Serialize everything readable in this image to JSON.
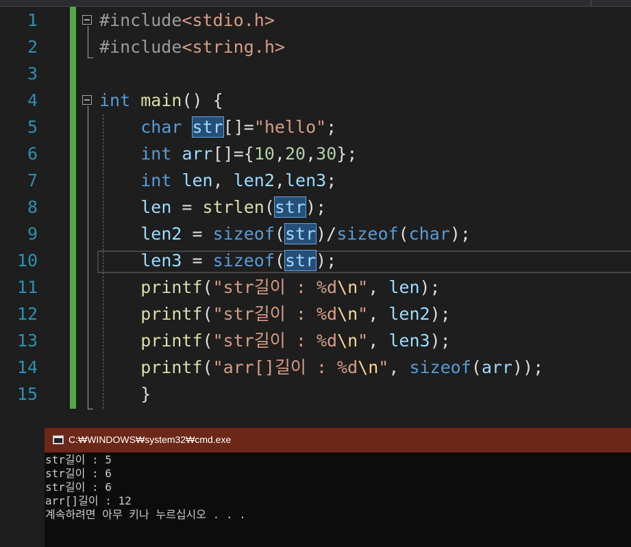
{
  "editor": {
    "lines": [
      {
        "num": "1",
        "segs": [
          [
            "#include",
            "inc"
          ],
          [
            "<stdio.h>",
            "str"
          ]
        ]
      },
      {
        "num": "2",
        "segs": [
          [
            "#include",
            "inc"
          ],
          [
            "<string.h>",
            "str"
          ]
        ]
      },
      {
        "num": "3",
        "segs": []
      },
      {
        "num": "4",
        "segs": [
          [
            "int",
            "kw"
          ],
          [
            " ",
            ""
          ],
          [
            "main",
            "fn"
          ],
          [
            "() {",
            ""
          ]
        ]
      },
      {
        "num": "5",
        "segs": [
          [
            "    ",
            ""
          ],
          [
            "char",
            "kw"
          ],
          [
            " ",
            ""
          ],
          [
            "str",
            "var hl"
          ],
          [
            "[]=",
            ""
          ],
          [
            "\"hello\"",
            "str"
          ],
          [
            ";",
            ""
          ]
        ]
      },
      {
        "num": "6",
        "segs": [
          [
            "    ",
            ""
          ],
          [
            "int",
            "kw"
          ],
          [
            " ",
            ""
          ],
          [
            "arr",
            "var"
          ],
          [
            "[]={",
            ""
          ],
          [
            "10",
            "num"
          ],
          [
            ",",
            ""
          ],
          [
            "20",
            "num"
          ],
          [
            ",",
            ""
          ],
          [
            "30",
            "num"
          ],
          [
            "};",
            ""
          ]
        ]
      },
      {
        "num": "7",
        "segs": [
          [
            "    ",
            ""
          ],
          [
            "int",
            "kw"
          ],
          [
            " ",
            ""
          ],
          [
            "len",
            "var"
          ],
          [
            ", ",
            ""
          ],
          [
            "len2",
            "var"
          ],
          [
            ",",
            ""
          ],
          [
            "len3",
            "var"
          ],
          [
            ";",
            ""
          ]
        ]
      },
      {
        "num": "8",
        "segs": [
          [
            "    ",
            ""
          ],
          [
            "len",
            "var"
          ],
          [
            " = ",
            ""
          ],
          [
            "strlen",
            "fn"
          ],
          [
            "(",
            ""
          ],
          [
            "str",
            "var hl"
          ],
          [
            ");",
            ""
          ]
        ]
      },
      {
        "num": "9",
        "segs": [
          [
            "    ",
            ""
          ],
          [
            "len2",
            "var"
          ],
          [
            " = ",
            ""
          ],
          [
            "sizeof",
            "kw"
          ],
          [
            "(",
            ""
          ],
          [
            "str",
            "var hl"
          ],
          [
            ")/",
            ""
          ],
          [
            "sizeof",
            "kw"
          ],
          [
            "(",
            ""
          ],
          [
            "char",
            "kw"
          ],
          [
            ");",
            ""
          ]
        ]
      },
      {
        "num": "10",
        "segs": [
          [
            "    ",
            ""
          ],
          [
            "len3",
            "var"
          ],
          [
            " = ",
            ""
          ],
          [
            "sizeof",
            "kw"
          ],
          [
            "(",
            ""
          ],
          [
            "str",
            "var hl"
          ],
          [
            ");",
            ""
          ]
        ]
      },
      {
        "num": "11",
        "segs": [
          [
            "    ",
            ""
          ],
          [
            "printf",
            "fn"
          ],
          [
            "(",
            ""
          ],
          [
            "\"str길이 : %d",
            "str"
          ],
          [
            "\\n",
            "esc"
          ],
          [
            "\"",
            "str"
          ],
          [
            ", ",
            ""
          ],
          [
            "len",
            "var"
          ],
          [
            ");",
            ""
          ]
        ]
      },
      {
        "num": "12",
        "segs": [
          [
            "    ",
            ""
          ],
          [
            "printf",
            "fn"
          ],
          [
            "(",
            ""
          ],
          [
            "\"str길이 : %d",
            "str"
          ],
          [
            "\\n",
            "esc"
          ],
          [
            "\"",
            "str"
          ],
          [
            ", ",
            ""
          ],
          [
            "len2",
            "var"
          ],
          [
            ");",
            ""
          ]
        ]
      },
      {
        "num": "13",
        "segs": [
          [
            "    ",
            ""
          ],
          [
            "printf",
            "fn"
          ],
          [
            "(",
            ""
          ],
          [
            "\"str길이 : %d",
            "str"
          ],
          [
            "\\n",
            "esc"
          ],
          [
            "\"",
            "str"
          ],
          [
            ", ",
            ""
          ],
          [
            "len3",
            "var"
          ],
          [
            ");",
            ""
          ]
        ]
      },
      {
        "num": "14",
        "segs": [
          [
            "    ",
            ""
          ],
          [
            "printf",
            "fn"
          ],
          [
            "(",
            ""
          ],
          [
            "\"arr[]길이 : %d",
            "str"
          ],
          [
            "\\n",
            "esc"
          ],
          [
            "\"",
            "str"
          ],
          [
            ", ",
            ""
          ],
          [
            "sizeof",
            "kw"
          ],
          [
            "(",
            ""
          ],
          [
            "arr",
            "var"
          ],
          [
            "));",
            ""
          ]
        ]
      },
      {
        "num": "15",
        "segs": [
          [
            "    }",
            ""
          ]
        ]
      }
    ],
    "colors": {
      "keyword": "#569cd6",
      "function": "#dcdcaa",
      "string": "#d69d85",
      "number": "#b5cea8",
      "variable": "#9cdcfe",
      "line_number": "#2b91af",
      "highlight": "#264f78"
    }
  },
  "console": {
    "title": "C:₩WINDOWS₩system32₩cmd.exe",
    "icon": "console-icon",
    "output": [
      "str길이 : 5",
      "str길이 : 6",
      "str길이 : 6",
      "arr[]길이 : 12",
      "계속하려면 아무 키나 누르십시오 . . ."
    ]
  }
}
